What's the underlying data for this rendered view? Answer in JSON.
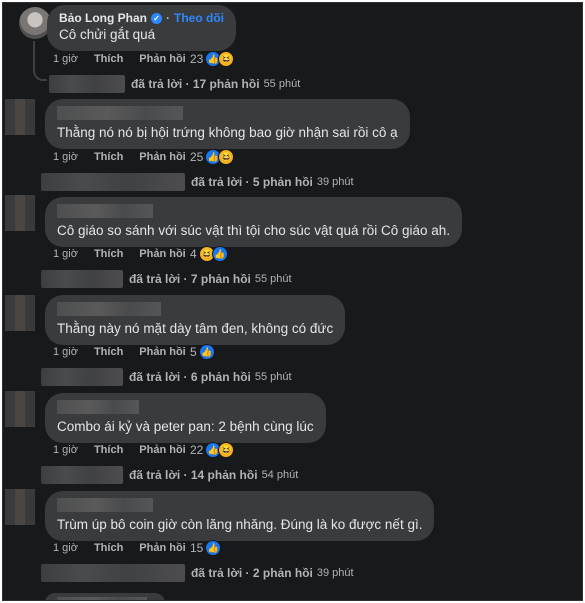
{
  "comments": [
    {
      "author": "Bảo Long Phan",
      "follow_label": "Theo dõi",
      "text": "Cô chửi gắt quá",
      "time": "1 giờ",
      "like": "Thích",
      "reply": "Phản hồi",
      "reaction_count": "23",
      "reactions": [
        "like-icon",
        "haha-icon"
      ],
      "replies_summary": "đã trả lời · 17 phản hồi",
      "replies_time": "55 phút"
    },
    {
      "text": "Thằng nó nó bị hội trứng không bao giờ nhận sai rồi cô ạ",
      "time": "1 giờ",
      "like": "Thích",
      "reply": "Phản hồi",
      "reaction_count": "25",
      "reactions": [
        "like-icon",
        "haha-icon"
      ],
      "replies_summary": "đã trả lời · 5 phản hồi",
      "replies_time": "39 phút"
    },
    {
      "text": "Cô giáo so sánh với súc vật thì tội cho súc vật quá rồi Cô giáo ah.",
      "time": "1 giờ",
      "like": "Thích",
      "reply": "Phản hồi",
      "reaction_count": "4",
      "reactions": [
        "haha-icon",
        "like-icon"
      ],
      "replies_summary": "đã trả lời · 7 phản hồi",
      "replies_time": "55 phút"
    },
    {
      "text": "Thằng này nó mặt dày tâm đen, không có đức",
      "time": "1 giờ",
      "like": "Thích",
      "reply": "Phản hồi",
      "reaction_count": "5",
      "reactions": [
        "like-icon"
      ],
      "replies_summary": "đã trả lời · 6 phản hồi",
      "replies_time": "55 phút"
    },
    {
      "text": "Combo ái kỷ và peter pan: 2 bệnh cùng lúc",
      "time": "1 giờ",
      "like": "Thích",
      "reply": "Phản hồi",
      "reaction_count": "22",
      "reactions": [
        "like-icon",
        "haha-icon"
      ],
      "replies_summary": "đã trả lời · 14 phản hồi",
      "replies_time": "54 phút"
    },
    {
      "text": "Trùm úp bô coin giờ còn lăng nhăng. Đúng là ko được nết gì.",
      "time": "1 giờ",
      "like": "Thích",
      "reply": "Phản hồi",
      "reaction_count": "15",
      "reactions": [
        "like-icon"
      ],
      "replies_summary": "đã trả lời · 2 phản hồi",
      "replies_time": "39 phút"
    }
  ],
  "colors": {
    "background": "#18191a",
    "bubble": "#3a3b3c",
    "text": "#e4e6eb",
    "secondary": "#b0b3b8",
    "accent": "#2d88ff"
  }
}
